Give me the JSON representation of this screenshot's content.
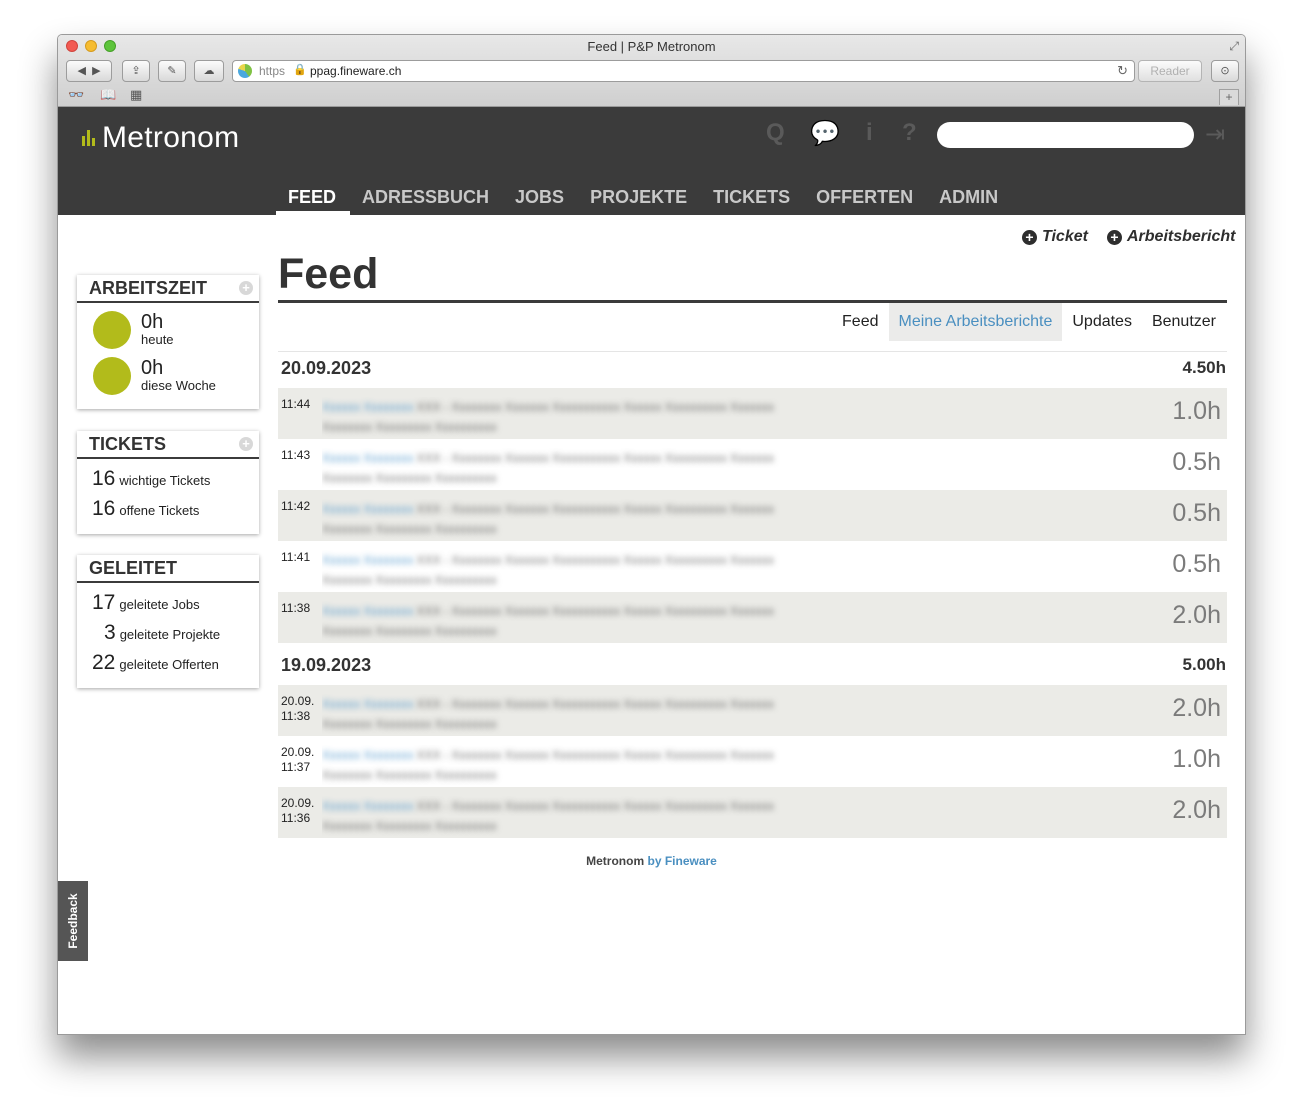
{
  "browser": {
    "title": "Feed | P&P Metronom",
    "url_scheme": "https",
    "url": "ppag.fineware.ch",
    "reader_label": "Reader"
  },
  "app": {
    "logo": "Metronom",
    "nav": [
      "FEED",
      "ADRESSBUCH",
      "JOBS",
      "PROJEKTE",
      "TICKETS",
      "OFFERTEN",
      "ADMIN"
    ],
    "active_nav": "FEED",
    "header_icons": [
      "search-icon",
      "chat-icon",
      "info-icon",
      "help-icon",
      "logout-icon"
    ]
  },
  "sidebar": {
    "arbeitszeit": {
      "title": "ARBEITSZEIT",
      "rows": [
        {
          "value": "0h",
          "label": "heute"
        },
        {
          "value": "0h",
          "label": "diese Woche"
        }
      ]
    },
    "tickets": {
      "title": "TICKETS",
      "rows": [
        {
          "count": "16",
          "label": "wichtige Tickets"
        },
        {
          "count": "16",
          "label": "offene Tickets"
        }
      ]
    },
    "geleitet": {
      "title": "GELEITET",
      "rows": [
        {
          "count": "17",
          "label": "geleitete Jobs"
        },
        {
          "count": "3",
          "label": "geleitete Projekte"
        },
        {
          "count": "22",
          "label": "geleitete Offerten"
        }
      ]
    }
  },
  "actions": {
    "ticket": "Ticket",
    "arbeitsbericht": "Arbeitsbericht"
  },
  "page": {
    "title": "Feed",
    "tabs": [
      "Feed",
      "Meine Arbeitsberichte",
      "Updates",
      "Benutzer"
    ],
    "active_tab": "Meine Arbeitsberichte"
  },
  "days": [
    {
      "date": "20.09.2023",
      "total": "4.50h",
      "entries": [
        {
          "time": "11:44",
          "hours": "1.0h"
        },
        {
          "time": "11:43",
          "hours": "0.5h"
        },
        {
          "time": "11:42",
          "hours": "0.5h"
        },
        {
          "time": "11:41",
          "hours": "0.5h"
        },
        {
          "time": "11:38",
          "hours": "2.0h"
        }
      ]
    },
    {
      "date": "19.09.2023",
      "total": "5.00h",
      "entries": [
        {
          "date": "20.09.",
          "time": "11:38",
          "hours": "2.0h"
        },
        {
          "date": "20.09.",
          "time": "11:37",
          "hours": "1.0h"
        },
        {
          "date": "20.09.",
          "time": "11:36",
          "hours": "2.0h"
        }
      ]
    }
  ],
  "footer": {
    "brand": "Metronom",
    "by": "by Fineware"
  },
  "feedback_label": "Feedback",
  "colors": {
    "header_bg": "#3b3b3b",
    "indicator": "#b2bb1b",
    "accent": "#4a8fc0",
    "row_shade": "#ebebe7"
  }
}
